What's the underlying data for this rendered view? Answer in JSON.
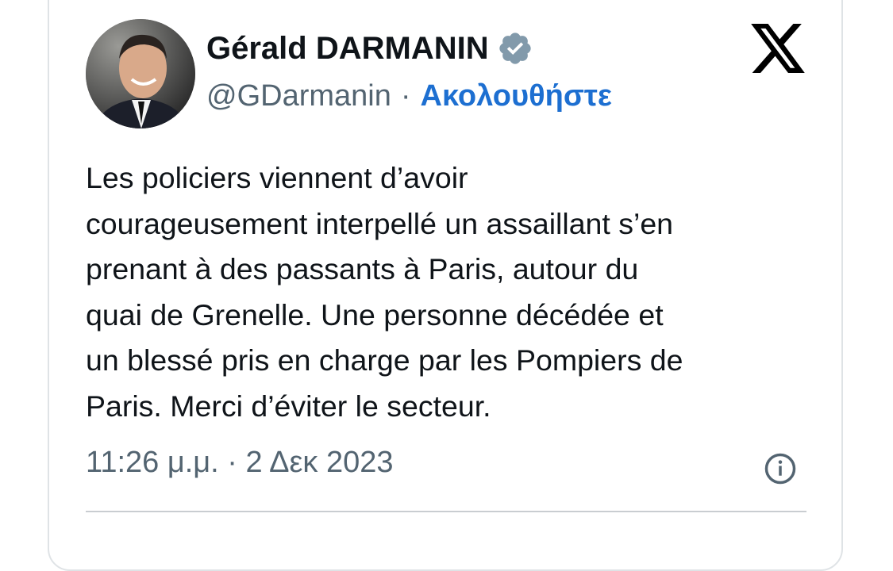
{
  "tweet": {
    "author_name": "Gérald DARMANIN",
    "handle": "@GDarmanin",
    "separator": "·",
    "follow_label": "Ακολουθήστε",
    "text_lines": [
      "Les policiers viennent d’avoir",
      "courageusement interpellé un assaillant s’en",
      "prenant à des passants à Paris, autour du",
      "quai de Grenelle. Une personne décédée et",
      "un blessé pris en charge par les Pompiers de",
      "Paris. Merci d’éviter le secteur."
    ],
    "time": "11:26 μ.μ.",
    "date": "2 Δεκ 2023",
    "meta_separator": "·"
  },
  "icons": {
    "verified": "verified-badge-icon",
    "platform": "x-logo-icon",
    "info": "info-icon"
  },
  "colors": {
    "text": "#0f1419",
    "secondary": "#536471",
    "follow": "#1d6fd1",
    "verified_badge": "#829aab",
    "border": "#dfe3e6"
  }
}
